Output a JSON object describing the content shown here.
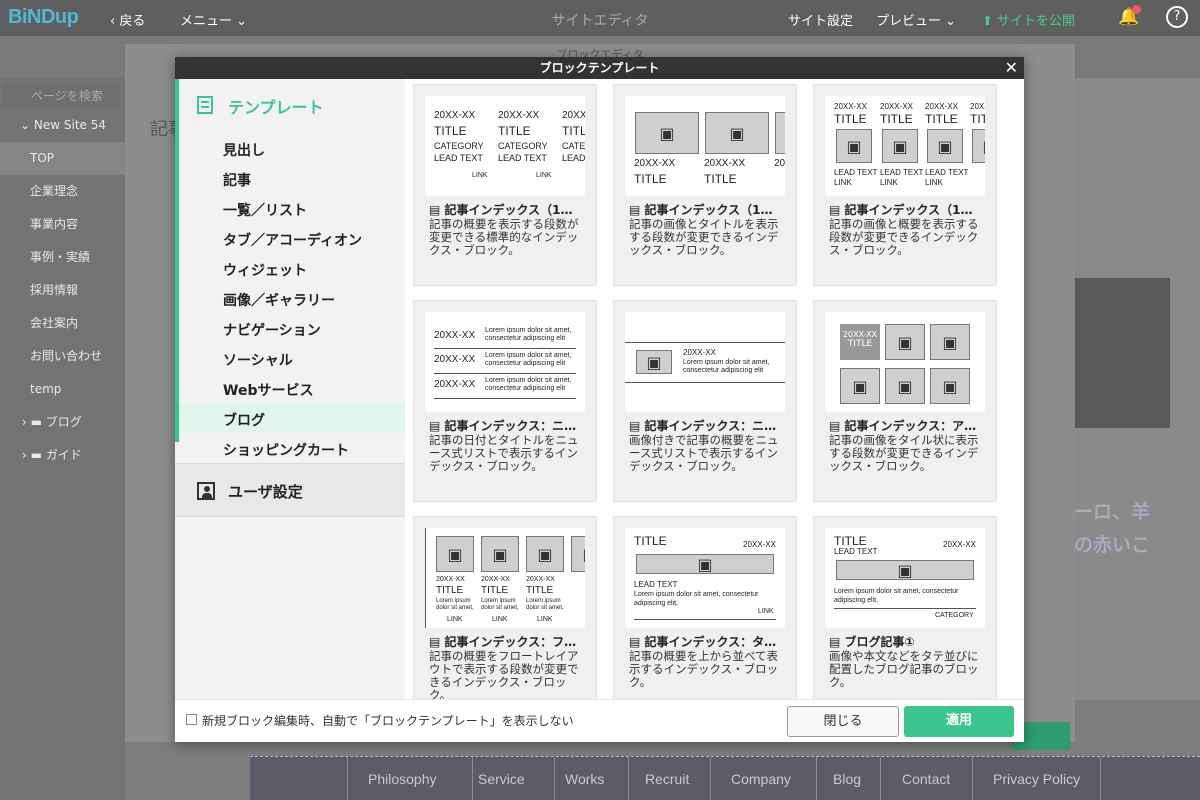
{
  "app": {
    "logo": "BiNDup",
    "back": "戻る",
    "menu": "メニュー",
    "center_title": "サイトエディタ",
    "site_settings": "サイト設定",
    "preview": "プレビュー",
    "publish": "サイトを公開"
  },
  "left": {
    "search_placeholder": "ページを検索",
    "site": "New Site 54",
    "pages": [
      "TOP",
      "企業理念",
      "事業内容",
      "事例・実績",
      "採用情報",
      "会社案内",
      "お問い合わせ",
      "temp"
    ],
    "folders": [
      "ブログ",
      "ガイド"
    ]
  },
  "block_editor": {
    "title": "ブロックエディタ",
    "label": "記事"
  },
  "right": {
    "text1": "ーロ、羊",
    "text2": "の赤いこ"
  },
  "modal": {
    "title": "ブロックテンプレート",
    "sidebar": {
      "header": "テンプレート",
      "categories": [
        "見出し",
        "記事",
        "一覧／リスト",
        "タブ／アコーディオン",
        "ウィジェット",
        "画像／ギャラリー",
        "ナビゲーション",
        "ソーシャル",
        "Webサービス",
        "ブログ",
        "ショッピングカート"
      ],
      "selected": "ブログ",
      "user": "ユーザ設定"
    },
    "cards": [
      {
        "title": "記事インデックス（1…",
        "desc": "記事の概要を表示する段数が変更できる標準的なインデックス・ブロック。"
      },
      {
        "title": "記事インデックス（1…",
        "desc": "記事の画像とタイトルを表示する段数が変更できるインデックス・ブロック。"
      },
      {
        "title": "記事インデックス（1…",
        "desc": "記事の画像と概要を表示する段数が変更できるインデックス・ブロック。"
      },
      {
        "title": "記事インデックス：ニ…",
        "desc": "記事の日付とタイトルをニュース式リストで表示するインデックス・ブロック。"
      },
      {
        "title": "記事インデックス：ニ…",
        "desc": "画像付きで記事の概要をニュース式リストで表示するインデックス・ブロック。"
      },
      {
        "title": "記事インデックス：ア…",
        "desc": "記事の画像をタイル状に表示する段数が変更できるインデックス・ブロック。"
      },
      {
        "title": "記事インデックス：フ…",
        "desc": "記事の概要をフロートレイアウトで表示する段数が変更できるインデックス・ブロック。"
      },
      {
        "title": "記事インデックス：タ…",
        "desc": "記事の概要を上から並べて表示するインデックス・ブロック。"
      },
      {
        "title": "ブログ記事①",
        "desc": "画像や本文などをタテ並びに配置したブログ記事のブロック。"
      }
    ],
    "thumb": {
      "date": "20XX-XX",
      "title": "TITLE",
      "category": "CATEGORY",
      "lead": "LEAD TEXT",
      "link": "LINK",
      "lorem": "Lorem ipsum dolor sit amet,",
      "lorem2": "consectetur adipiscing elit",
      "lorem_short": "Lorem ipsum dolor sit amet, consectetur",
      "lorem_short2": "adipiscing elit,",
      "lorem_tiny": "Lorem ipsum",
      "lorem_tiny2": "dolor sit amet,"
    },
    "checkbox_label": "新規ブロック編集時、自動で「ブロックテンプレート」を表示しない",
    "close_button": "閉じる",
    "apply_button": "適用"
  },
  "footer_nav": [
    "Philosophy",
    "Service",
    "Works",
    "Recruit",
    "Company",
    "Blog",
    "Contact",
    "Privacy Policy"
  ],
  "colors": {
    "accent": "#3cc48e",
    "topbar": "#5f5f5f",
    "modal_header": "#333333"
  }
}
